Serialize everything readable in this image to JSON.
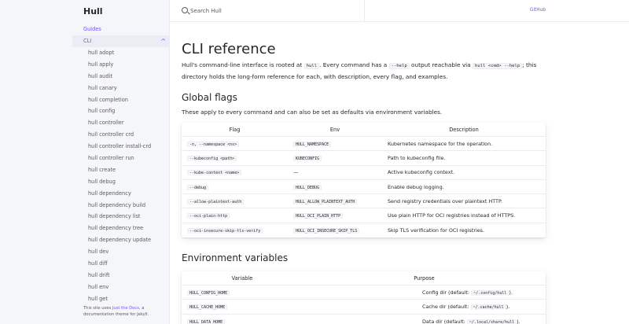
{
  "site": {
    "title": "Hull",
    "github_label": "GitHub"
  },
  "search": {
    "placeholder": "Search Hull"
  },
  "sidebar": {
    "top_items": [
      {
        "label": "Guides",
        "chevron": "›"
      },
      {
        "label": "CLI",
        "chevron": "⌄"
      }
    ],
    "commands": [
      "hull adopt",
      "hull apply",
      "hull audit",
      "hull canary",
      "hull completion",
      "hull config",
      "hull controller",
      "hull controller crd",
      "hull controller install-crd",
      "hull controller run",
      "hull create",
      "hull debug",
      "hull dependency",
      "hull dependency build",
      "hull dependency list",
      "hull dependency tree",
      "hull dependency update",
      "hull dev",
      "hull diff",
      "hull drift",
      "hull env",
      "hull get"
    ],
    "footer": {
      "prefix": "This site uses ",
      "link": "Just the Docs",
      "suffix": ", a documentation theme for Jekyll."
    }
  },
  "page": {
    "title": "CLI reference",
    "intro": {
      "t1": "Hull's command-line interface is rooted at ",
      "c1": "hull",
      "t2": ". Every command has a ",
      "c2": "--help",
      "t3": " output reachable via ",
      "c3": "hull <cmd> --help",
      "t4": "; this directory holds the long-form reference for each, with description, every flag, and examples."
    },
    "global_flags": {
      "heading": "Global flags",
      "description": "These apply to every command and can also be set as defaults via environment variables.",
      "columns": [
        "Flag",
        "Env",
        "Description"
      ],
      "rows": [
        {
          "flag": "-n, --namespace <ns>",
          "env": "HULL_NAMESPACE",
          "desc": "Kubernetes namespace for the operation."
        },
        {
          "flag": "--kubeconfig <path>",
          "env": "KUBECONFIG",
          "desc": "Path to kubeconfig file."
        },
        {
          "flag": "--kube-context <name>",
          "env": "",
          "env_text": "—",
          "desc": "Active kubeconfig context."
        },
        {
          "flag": "--debug",
          "env": "HULL_DEBUG",
          "desc": "Enable debug logging."
        },
        {
          "flag": "--allow-plaintext-auth",
          "env": "HULL_ALLOW_PLAINTEXT_AUTH",
          "desc": "Send registry credentials over plaintext HTTP."
        },
        {
          "flag": "--oci-plain-http",
          "env": "HULL_OCI_PLAIN_HTTP",
          "desc": "Use plain HTTP for OCI registries instead of HTTPS."
        },
        {
          "flag": "--oci-insecure-skip-tls-verify",
          "env": "HULL_OCI_INSECURE_SKIP_TLS",
          "desc": "Skip TLS verification for OCI registries."
        }
      ]
    },
    "env_vars": {
      "heading": "Environment variables",
      "columns": [
        "Variable",
        "Purpose"
      ],
      "rows": [
        {
          "var": "HULL_CONFIG_HOME",
          "purpose": "Config dir (default: ",
          "path": "~/.config/hull",
          "end": ")."
        },
        {
          "var": "HULL_CACHE_HOME",
          "purpose": "Cache dir (default: ",
          "path": "~/.cache/hull",
          "end": ")."
        },
        {
          "var": "HULL_DATA_HOME",
          "purpose": "Data dir (default: ",
          "path": "~/.local/share/hull",
          "end": ")."
        }
      ]
    }
  },
  "colors": {
    "accent": "#7253ed",
    "text": "#27262b",
    "muted": "#5c5962",
    "sidebar_bg": "#f5f6fa",
    "border": "#eeebee"
  }
}
